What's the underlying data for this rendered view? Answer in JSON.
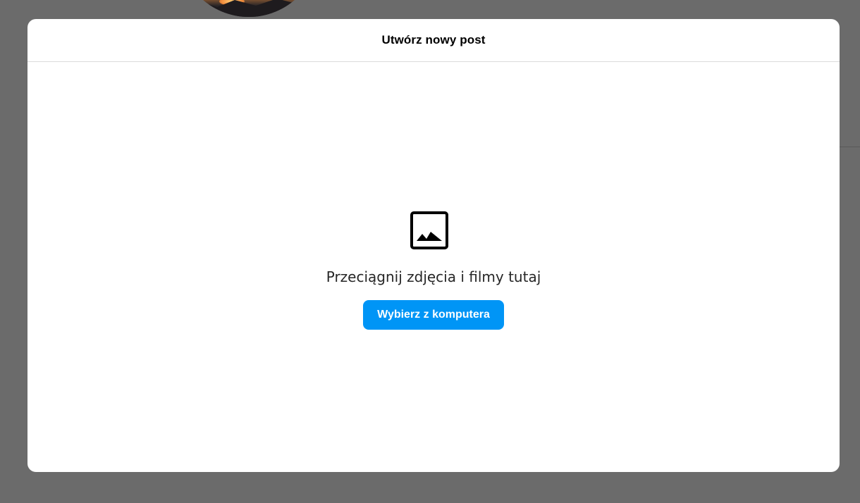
{
  "modal": {
    "title": "Utwórz nowy post",
    "drag_text": "Przeciągnij zdjęcia i filmy tutaj",
    "select_button_label": "Wybierz z komputera",
    "media_icon": "photo-video-icon"
  },
  "colors": {
    "backdrop": "#6b6b6b",
    "modal_background": "#ffffff",
    "accent": "#0095f6",
    "divider": "#dbdbdb"
  }
}
